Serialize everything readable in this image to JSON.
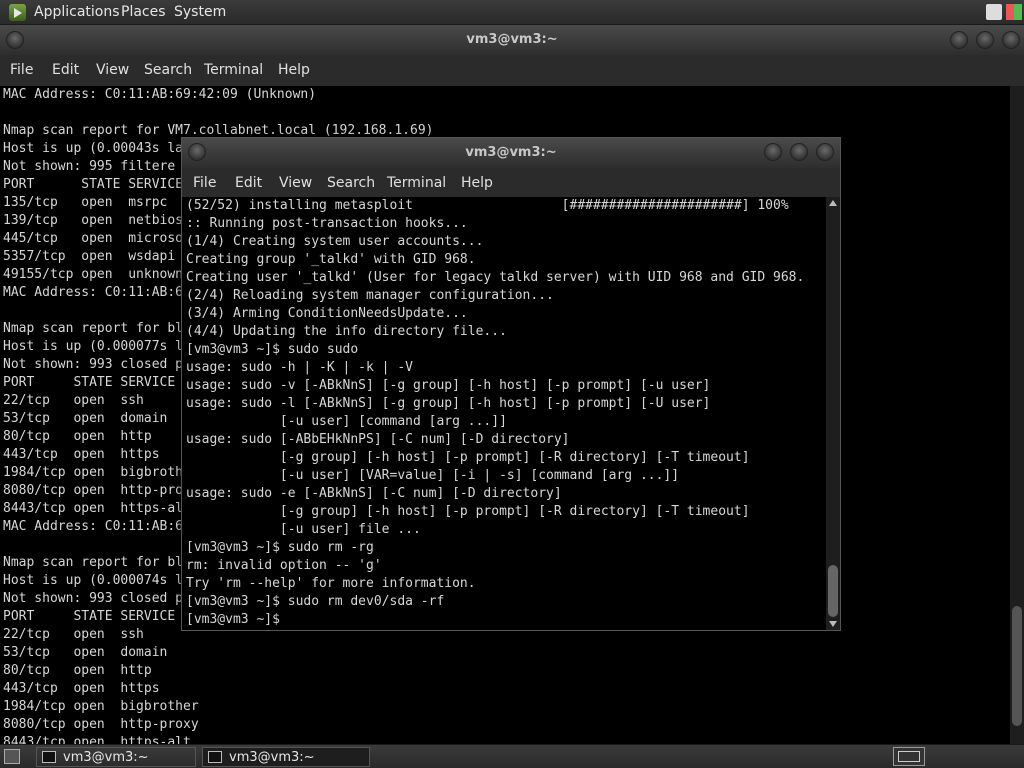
{
  "top_panel": {
    "menus": [
      "Applications",
      "Places",
      "System"
    ]
  },
  "back_window": {
    "title": "vm3@vm3:~",
    "menu": [
      "File",
      "Edit",
      "View",
      "Search",
      "Terminal",
      "Help"
    ],
    "lines": [
      "MAC Address: C0:11:AB:69:42:09 (Unknown)",
      "",
      "Nmap scan report for VM7.collabnet.local (192.168.1.69)",
      "Host is up (0.00043s la",
      "Not shown: 995 filtere",
      "PORT      STATE SERVICE",
      "135/tcp   open  msrpc",
      "139/tcp   open  netbios",
      "445/tcp   open  microso",
      "5357/tcp  open  wsdapi",
      "49155/tcp open  unknown",
      "MAC Address: C0:11:AB:6",
      "",
      "Nmap scan report for bl",
      "Host is up (0.000077s l",
      "Not shown: 993 closed p",
      "PORT     STATE SERVICE",
      "22/tcp   open  ssh",
      "53/tcp   open  domain",
      "80/tcp   open  http",
      "443/tcp  open  https",
      "1984/tcp open  bigbroth",
      "8080/tcp open  http-pro",
      "8443/tcp open  https-al",
      "MAC Address: C0:11:AB:6",
      "",
      "Nmap scan report for bl",
      "Host is up (0.000074s l",
      "Not shown: 993 closed p",
      "PORT     STATE SERVICE",
      "22/tcp   open  ssh",
      "53/tcp   open  domain",
      "80/tcp   open  http",
      "443/tcp  open  https",
      "1984/tcp open  bigbrother",
      "8080/tcp open  http-proxy",
      "8443/tcp open  https-alt"
    ]
  },
  "front_window": {
    "title": "vm3@vm3:~",
    "menu": [
      "File",
      "Edit",
      "View",
      "Search",
      "Terminal",
      "Help"
    ],
    "lines": [
      "(52/52) installing metasploit                   [######################] 100%",
      ":: Running post-transaction hooks...",
      "(1/4) Creating system user accounts...",
      "Creating group '_talkd' with GID 968.",
      "Creating user '_talkd' (User for legacy talkd server) with UID 968 and GID 968.",
      "(2/4) Reloading system manager configuration...",
      "(3/4) Arming ConditionNeedsUpdate...",
      "(4/4) Updating the info directory file...",
      "[vm3@vm3 ~]$ sudo sudo",
      "usage: sudo -h | -K | -k | -V",
      "usage: sudo -v [-ABkNnS] [-g group] [-h host] [-p prompt] [-u user]",
      "usage: sudo -l [-ABkNnS] [-g group] [-h host] [-p prompt] [-U user]",
      "            [-u user] [command [arg ...]]",
      "usage: sudo [-ABbEHkNnPS] [-C num] [-D directory]",
      "            [-g group] [-h host] [-p prompt] [-R directory] [-T timeout]",
      "            [-u user] [VAR=value] [-i | -s] [command [arg ...]]",
      "usage: sudo -e [-ABkNnS] [-C num] [-D directory]",
      "            [-g group] [-h host] [-p prompt] [-R directory] [-T timeout]",
      "            [-u user] file ...",
      "[vm3@vm3 ~]$ sudo rm -rg",
      "rm: invalid option -- 'g'",
      "Try 'rm --help' for more information.",
      "[vm3@vm3 ~]$ sudo rm dev0/sda -rf",
      "[vm3@vm3 ~]$"
    ]
  },
  "taskbar": {
    "tasks": [
      "vm3@vm3:~",
      "vm3@vm3:~"
    ]
  }
}
